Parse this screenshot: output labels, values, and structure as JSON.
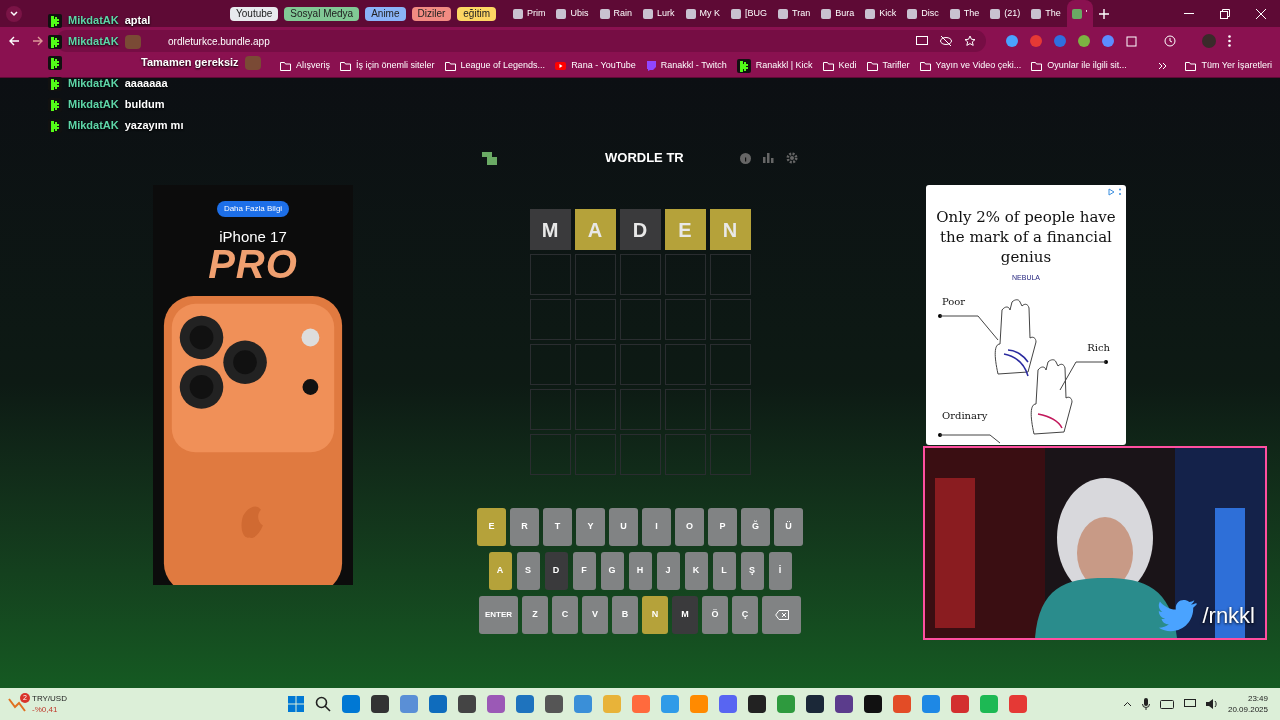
{
  "chat": [
    {
      "user": "MikdatAK",
      "text": "aptal",
      "emote": false
    },
    {
      "user": "MikdatAK",
      "emote": true
    },
    {
      "text": "Tamamen gereksiz",
      "emote": true
    },
    {
      "user": "MikdatAK",
      "text": "aaaaaaa",
      "emote": false
    },
    {
      "user": "MikdatAK",
      "text": "buldum",
      "emote": false
    },
    {
      "user": "MikdatAK",
      "text": "yazayım mı",
      "emote": false
    }
  ],
  "tab_groups": [
    {
      "label": "Youtube",
      "color": "#e8eaed"
    },
    {
      "label": "Sosyal Medya",
      "color": "#81c995"
    },
    {
      "label": "Anime",
      "color": "#8ab4f8"
    },
    {
      "label": "Diziler",
      "color": "#f28b82"
    },
    {
      "label": "eğitim",
      "color": "#fdd663"
    }
  ],
  "tabs": [
    {
      "label": "Prim",
      "selected": false
    },
    {
      "label": "Ubis",
      "selected": false
    },
    {
      "label": "Rain",
      "selected": false
    },
    {
      "label": "Lurk",
      "selected": false
    },
    {
      "label": "My K",
      "selected": false
    },
    {
      "label": "[BUG",
      "selected": false
    },
    {
      "label": "Tran",
      "selected": false
    },
    {
      "label": "Bura",
      "selected": false
    },
    {
      "label": "Kick",
      "selected": false
    },
    {
      "label": "Disc",
      "selected": false
    },
    {
      "label": "The",
      "selected": false
    },
    {
      "label": "(21)",
      "selected": false
    },
    {
      "label": "The",
      "selected": false
    },
    {
      "label": "'",
      "selected": true
    }
  ],
  "address": {
    "url": "ordleturkce.bundle.app"
  },
  "bookmarks": [
    {
      "label": "Alışveriş",
      "kind": "folder"
    },
    {
      "label": "İş için önemli siteler",
      "kind": "folder"
    },
    {
      "label": "League of Legends...",
      "kind": "folder"
    },
    {
      "label": "Rana - YouTube",
      "kind": "youtube"
    },
    {
      "label": "Ranakkl - Twitch",
      "kind": "twitch"
    },
    {
      "label": "Ranakkl | Kick",
      "kind": "kick"
    },
    {
      "label": "Kedi",
      "kind": "folder"
    },
    {
      "label": "Tarifler",
      "kind": "folder"
    },
    {
      "label": "Yayın ve Video çeki...",
      "kind": "folder"
    },
    {
      "label": "Oyunlar ile ilgili sit...",
      "kind": "folder"
    }
  ],
  "all_bookmarks": "Tüm Yer İşaretleri",
  "left_ad": {
    "button": "Daha Fazla Bilgi",
    "brand": "iPhone 17",
    "model": "PRO"
  },
  "game": {
    "title": "WORDLE TR",
    "rows": [
      [
        {
          "letter": "M",
          "color": "#3a3a3c"
        },
        {
          "letter": "A",
          "color": "#b5a23a"
        },
        {
          "letter": "D",
          "color": "#3a3a3c"
        },
        {
          "letter": "E",
          "color": "#b5a23a"
        },
        {
          "letter": "N",
          "color": "#b5a23a"
        }
      ],
      [],
      [],
      [],
      [],
      []
    ],
    "keyboard": [
      [
        {
          "label": "E",
          "color": "#b5a23a",
          "kind": "letter"
        },
        {
          "label": "R",
          "color": "#818384",
          "kind": "letter"
        },
        {
          "label": "T",
          "color": "#818384",
          "kind": "letter"
        },
        {
          "label": "Y",
          "color": "#818384",
          "kind": "letter"
        },
        {
          "label": "U",
          "color": "#818384",
          "kind": "letter"
        },
        {
          "label": "I",
          "color": "#818384",
          "kind": "letter"
        },
        {
          "label": "O",
          "color": "#818384",
          "kind": "letter"
        },
        {
          "label": "P",
          "color": "#818384",
          "kind": "letter"
        },
        {
          "label": "Ğ",
          "color": "#818384",
          "kind": "letter"
        },
        {
          "label": "Ü",
          "color": "#818384",
          "kind": "letter"
        }
      ],
      [
        {
          "label": "A",
          "color": "#b5a23a",
          "kind": "letter"
        },
        {
          "label": "S",
          "color": "#818384",
          "kind": "letter"
        },
        {
          "label": "D",
          "color": "#3a3a3c",
          "kind": "letter"
        },
        {
          "label": "F",
          "color": "#818384",
          "kind": "letter"
        },
        {
          "label": "G",
          "color": "#818384",
          "kind": "letter"
        },
        {
          "label": "H",
          "color": "#818384",
          "kind": "letter"
        },
        {
          "label": "J",
          "color": "#818384",
          "kind": "letter"
        },
        {
          "label": "K",
          "color": "#818384",
          "kind": "letter"
        },
        {
          "label": "L",
          "color": "#818384",
          "kind": "letter"
        },
        {
          "label": "Ş",
          "color": "#818384",
          "kind": "letter"
        },
        {
          "label": "İ",
          "color": "#818384",
          "kind": "letter"
        }
      ],
      [
        {
          "label": "ENTER",
          "color": "#818384",
          "kind": "wide"
        },
        {
          "label": "Z",
          "color": "#818384",
          "kind": "letter"
        },
        {
          "label": "C",
          "color": "#818384",
          "kind": "letter"
        },
        {
          "label": "V",
          "color": "#818384",
          "kind": "letter"
        },
        {
          "label": "B",
          "color": "#818384",
          "kind": "letter"
        },
        {
          "label": "N",
          "color": "#b5a23a",
          "kind": "letter"
        },
        {
          "label": "M",
          "color": "#3a3a3c",
          "kind": "letter"
        },
        {
          "label": "Ö",
          "color": "#818384",
          "kind": "letter"
        },
        {
          "label": "Ç",
          "color": "#818384",
          "kind": "letter"
        },
        {
          "color": "#818384",
          "kind": "backspace"
        }
      ]
    ]
  },
  "right_ad": {
    "headline": "Only 2% of people have the mark of a financial genius",
    "brand": "NEBULA",
    "labels": [
      "Poor",
      "Rich",
      "Ordinary"
    ]
  },
  "webcam": {
    "handle": "/rnkkl"
  },
  "taskbar": {
    "ticker": "TRY/USD",
    "change": "-%0,41",
    "badge": "2",
    "time": "23:49",
    "date": "20.09.2025"
  }
}
